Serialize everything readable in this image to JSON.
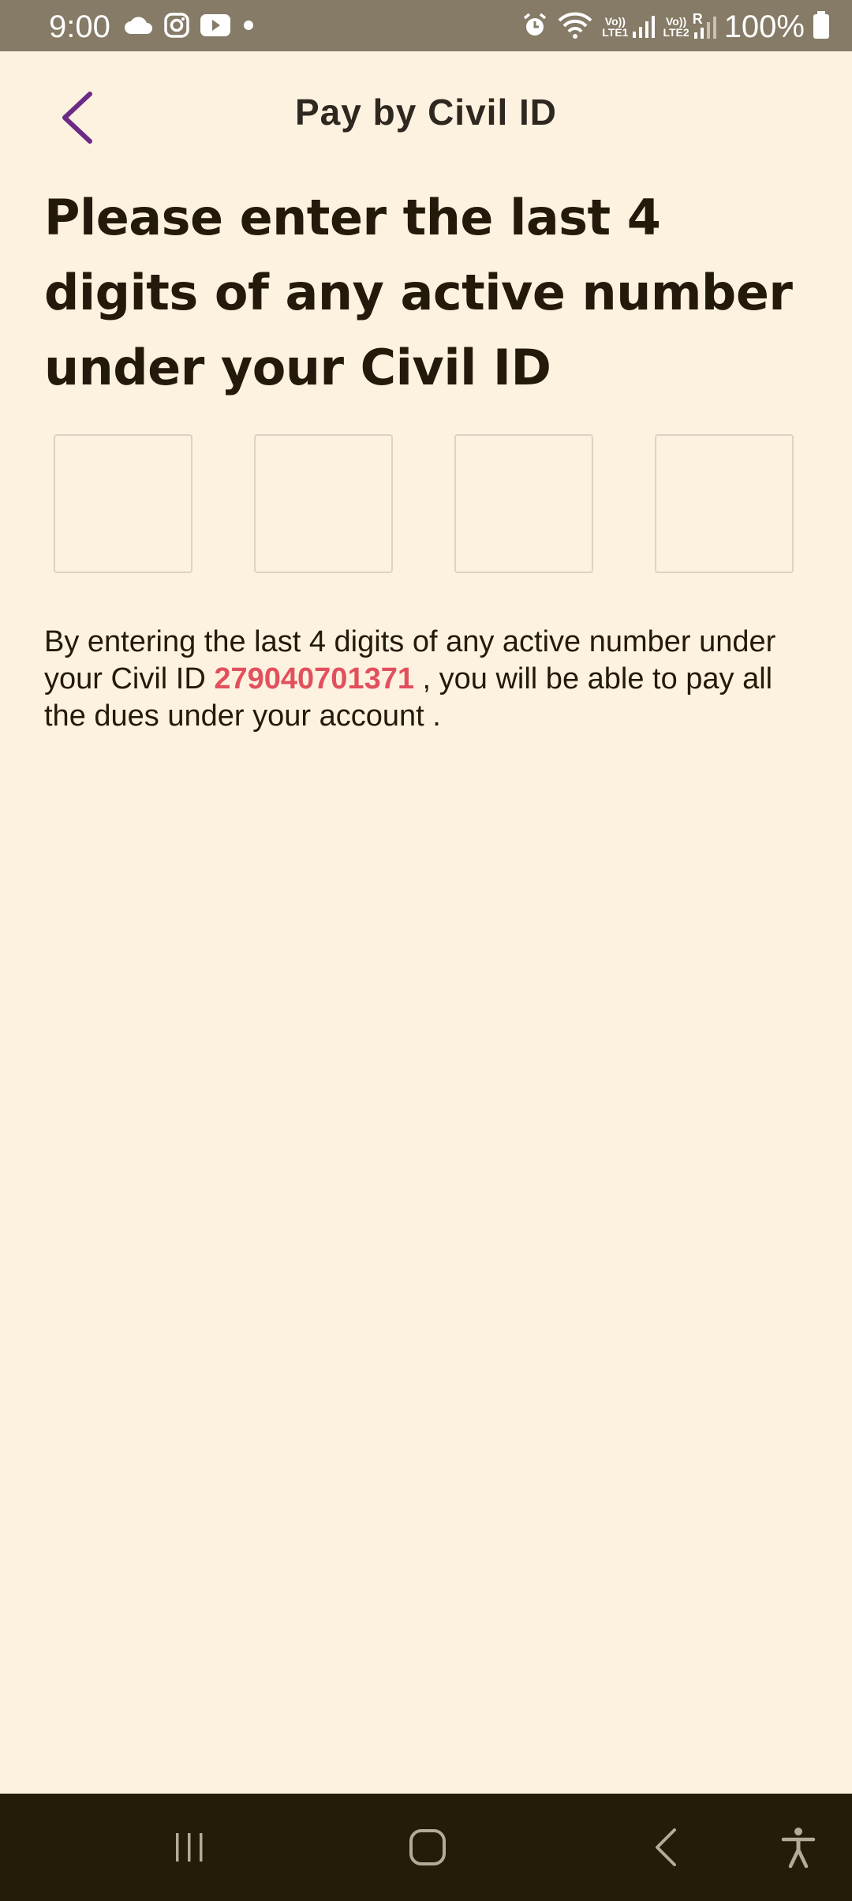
{
  "status_bar": {
    "time": "9:00",
    "battery": "100%",
    "left_icons": [
      "cloud-icon",
      "instagram-icon",
      "youtube-icon",
      "dot-icon"
    ],
    "right_icons": [
      "alarm-icon",
      "wifi-icon",
      "signal-sim1-icon",
      "signal-sim2-icon",
      "battery-icon"
    ],
    "sim1_label_top": "Vo))",
    "sim1_label_bottom": "LTE1",
    "sim2_label_top": "Vo))",
    "sim2_label_bottom": "LTE2",
    "roaming_label": "R"
  },
  "header": {
    "title": "Pay by Civil ID",
    "back_icon": "chevron-left-icon",
    "accent_color": "#6b2a86"
  },
  "heading": "Please enter the last 4 digits of any active number under your Civil ID",
  "pin_boxes": [
    {
      "value": ""
    },
    {
      "value": ""
    },
    {
      "value": ""
    },
    {
      "value": ""
    }
  ],
  "description": {
    "before": "By entering the last 4 digits of any active number under your Civil ID ",
    "civil_id": "279040701371",
    "after": " , you will be able to pay all the dues under your account ."
  },
  "colors": {
    "background": "#fdf2df",
    "status_bar": "#857b66",
    "nav_bar": "#241b08",
    "civil_id_highlight": "#e2505e",
    "text": "#231a0b"
  },
  "nav_bar": {
    "buttons": [
      "recent-apps-icon",
      "home-icon",
      "back-icon",
      "accessibility-icon"
    ]
  }
}
